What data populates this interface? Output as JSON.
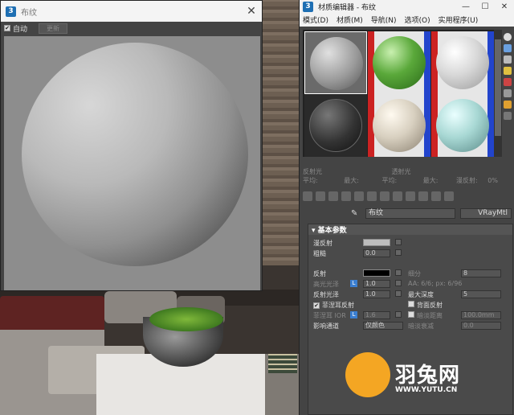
{
  "preview": {
    "title": "布纹",
    "app_badge": "3",
    "close": "✕",
    "auto_label": "自动",
    "update_label": "更新"
  },
  "editor": {
    "title": "材质编辑器 - 布纹",
    "app_badge": "3",
    "window_buttons": [
      "—",
      "☐",
      "✕"
    ],
    "menu": [
      "模式(D)",
      "材质(M)",
      "导航(N)",
      "选项(O)",
      "实用程序(U)"
    ],
    "info": {
      "reflect": "反射光",
      "refract": "透射光",
      "avg1": "平均:",
      "max1": "最大:",
      "avg2": "平均:",
      "max2": "最大:",
      "diffuse": "漫反射:",
      "pct": "0%"
    },
    "material_name": "布纹",
    "material_type": "VRayMtl",
    "rollout": "基本参数",
    "params": {
      "diffuse": "漫反射",
      "roughness": "粗糙",
      "roughness_val": "0.0",
      "reflect": "反射",
      "hilight_gloss": "高光光泽",
      "hilight_val": "1.0",
      "refl_gloss": "反射光泽",
      "refl_gloss_val": "1.0",
      "fresnel": "菲涅耳反射",
      "fresnel_ior": "菲涅耳 IOR",
      "fresnel_ior_val": "1.6",
      "affect_ch": "影响通道",
      "affect_ch_val": "仅颜色",
      "subdivs": "细分",
      "subdivs_val": "8",
      "aa": "AA: 6/6; px: 6/96",
      "max_depth": "最大深度",
      "max_depth_val": "5",
      "back_refl": "背面反射",
      "dim_dist": "暗淡距离",
      "dim_dist_val": "100.0mm",
      "dim_falloff": "暗淡衰减",
      "dim_falloff_val": "0.0",
      "L": "L"
    }
  },
  "watermark": {
    "text": "羽兔网",
    "url": "WWW.YUTU.CN"
  },
  "colors": {
    "diffuse_swatch": "#bdbdbd",
    "reflect_swatch": "#000000",
    "accent": "#f4a623"
  }
}
